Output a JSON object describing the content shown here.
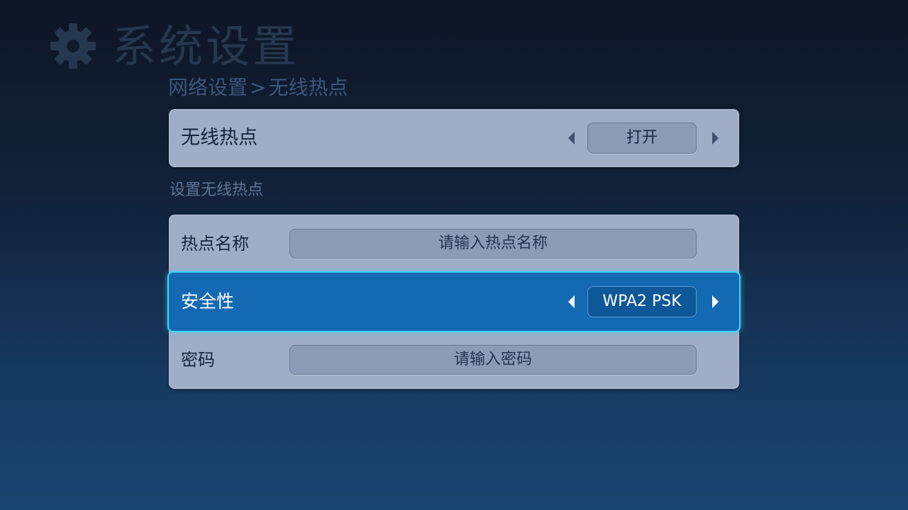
{
  "header": {
    "title": "系统设置",
    "icon": "gear-icon",
    "breadcrumb": {
      "parent": "网络设置",
      "separator": ">",
      "current": "无线热点"
    }
  },
  "hotspot_toggle": {
    "label": "无线热点",
    "value": "打开"
  },
  "section": {
    "label": "设置无线热点"
  },
  "settings": {
    "name": {
      "label": "热点名称",
      "placeholder": "请输入热点名称"
    },
    "security": {
      "label": "安全性",
      "value": "WPA2 PSK",
      "selected": true
    },
    "password": {
      "label": "密码",
      "placeholder": "请输入密码"
    }
  },
  "colors": {
    "background_top": "#0d1525",
    "background_bottom": "#1a4470",
    "panel": "#a0adc6",
    "selected_row": "#1469b3",
    "selected_glow": "#3fd3f5"
  }
}
